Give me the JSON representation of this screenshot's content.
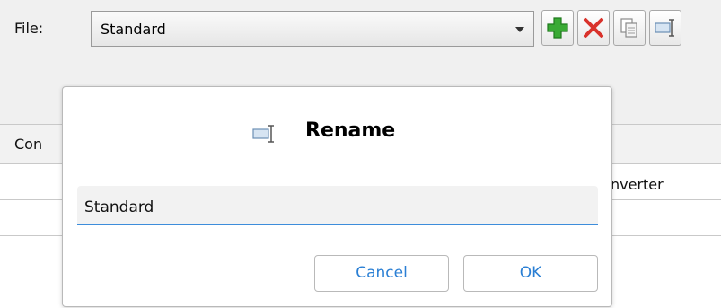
{
  "toolbar": {
    "file_label": "File:",
    "file_select": {
      "value": "Standard"
    },
    "buttons": [
      {
        "name": "add-button",
        "icon": "add-icon"
      },
      {
        "name": "delete-button",
        "icon": "delete-icon"
      },
      {
        "name": "copy-button",
        "icon": "copy-icon"
      },
      {
        "name": "rename-button",
        "icon": "rename-icon"
      }
    ]
  },
  "grid": {
    "header_text": "Con",
    "row_text": "nverter"
  },
  "dialog": {
    "title": "Rename",
    "icon": "rename-icon",
    "field_value": "Standard",
    "cancel_label": "Cancel",
    "ok_label": "OK"
  },
  "colors": {
    "accent": "#3d8ddb",
    "button_text": "#2a7fd4",
    "add_green": "#3aaa35",
    "delete_red": "#d9322b"
  }
}
